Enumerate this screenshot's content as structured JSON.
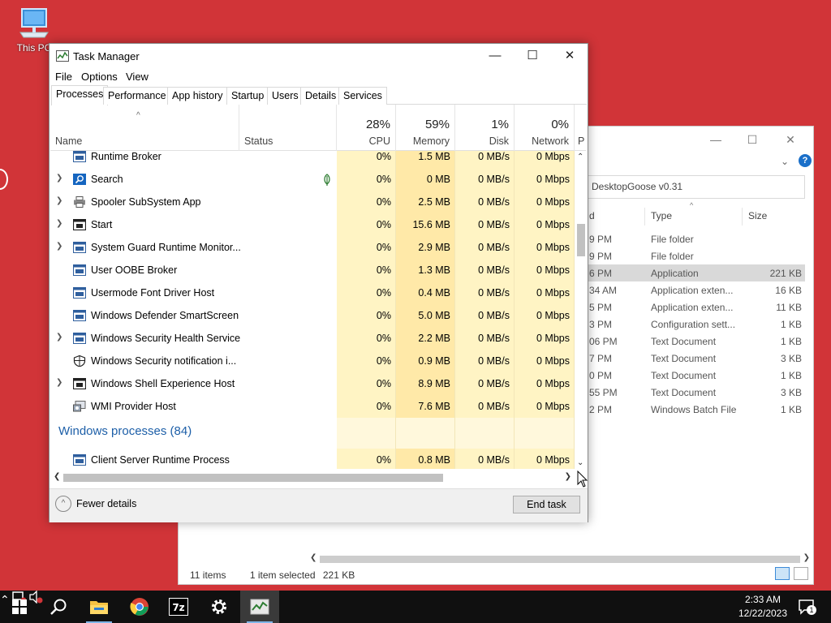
{
  "desktop": {
    "icon_label": "This PC"
  },
  "explorer": {
    "address": "DesktopGoose v0.31",
    "columns": {
      "date_fragment": "d",
      "type": "Type",
      "size": "Size"
    },
    "rows": [
      {
        "date": "9 PM",
        "type": "File folder",
        "size": ""
      },
      {
        "date": "9 PM",
        "type": "File folder",
        "size": ""
      },
      {
        "date": "6 PM",
        "type": "Application",
        "size": "221 KB",
        "selected": true
      },
      {
        "date": "34 AM",
        "type": "Application exten...",
        "size": "16 KB"
      },
      {
        "date": "5 PM",
        "type": "Application exten...",
        "size": "11 KB"
      },
      {
        "date": "3 PM",
        "type": "Configuration sett...",
        "size": "1 KB"
      },
      {
        "date": "06 PM",
        "type": "Text Document",
        "size": "1 KB"
      },
      {
        "date": "7 PM",
        "type": "Text Document",
        "size": "3 KB"
      },
      {
        "date": "0 PM",
        "type": "Text Document",
        "size": "1 KB"
      },
      {
        "date": "55 PM",
        "type": "Text Document",
        "size": "3 KB"
      },
      {
        "date": "2 PM",
        "type": "Windows Batch File",
        "size": "1 KB"
      }
    ],
    "status": {
      "items": "11 items",
      "selected": "1 item selected",
      "size": "221 KB"
    }
  },
  "taskmanager": {
    "title": "Task Manager",
    "menu": [
      "File",
      "Options",
      "View"
    ],
    "tabs": [
      "Processes",
      "Performance",
      "App history",
      "Startup",
      "Users",
      "Details",
      "Services"
    ],
    "active_tab": "Processes",
    "headers": {
      "name": "Name",
      "status": "Status",
      "cpu_pct": "28%",
      "cpu": "CPU",
      "mem_pct": "59%",
      "mem": "Memory",
      "disk_pct": "1%",
      "disk": "Disk",
      "net_pct": "0%",
      "net": "Network",
      "power_fragment": "P"
    },
    "processes": [
      {
        "name": "Runtime Broker",
        "expand": false,
        "icon": "app-window-icon",
        "cpu": "0%",
        "mem": "1.5 MB",
        "disk": "0 MB/s",
        "net": "0 Mbps"
      },
      {
        "name": "Search",
        "expand": true,
        "icon": "search-icon",
        "leaf": true,
        "cpu": "0%",
        "mem": "0 MB",
        "disk": "0 MB/s",
        "net": "0 Mbps"
      },
      {
        "name": "Spooler SubSystem App",
        "expand": true,
        "icon": "printer-icon",
        "cpu": "0%",
        "mem": "2.5 MB",
        "disk": "0 MB/s",
        "net": "0 Mbps"
      },
      {
        "name": "Start",
        "expand": true,
        "icon": "start-window-icon",
        "cpu": "0%",
        "mem": "15.6 MB",
        "disk": "0 MB/s",
        "net": "0 Mbps"
      },
      {
        "name": "System Guard Runtime Monitor...",
        "expand": true,
        "icon": "app-window-icon",
        "cpu": "0%",
        "mem": "2.9 MB",
        "disk": "0 MB/s",
        "net": "0 Mbps"
      },
      {
        "name": "User OOBE Broker",
        "expand": false,
        "icon": "app-window-icon",
        "cpu": "0%",
        "mem": "1.3 MB",
        "disk": "0 MB/s",
        "net": "0 Mbps"
      },
      {
        "name": "Usermode Font Driver Host",
        "expand": false,
        "icon": "app-window-icon",
        "cpu": "0%",
        "mem": "0.4 MB",
        "disk": "0 MB/s",
        "net": "0 Mbps"
      },
      {
        "name": "Windows Defender SmartScreen",
        "expand": false,
        "icon": "app-window-icon",
        "cpu": "0%",
        "mem": "5.0 MB",
        "disk": "0 MB/s",
        "net": "0 Mbps"
      },
      {
        "name": "Windows Security Health Service",
        "expand": true,
        "icon": "app-window-icon",
        "cpu": "0%",
        "mem": "2.2 MB",
        "disk": "0 MB/s",
        "net": "0 Mbps"
      },
      {
        "name": "Windows Security notification i...",
        "expand": false,
        "icon": "shield-icon",
        "cpu": "0%",
        "mem": "0.9 MB",
        "disk": "0 MB/s",
        "net": "0 Mbps"
      },
      {
        "name": "Windows Shell Experience Host",
        "expand": true,
        "icon": "start-window-icon",
        "cpu": "0%",
        "mem": "8.9 MB",
        "disk": "0 MB/s",
        "net": "0 Mbps"
      },
      {
        "name": "WMI Provider Host",
        "expand": false,
        "icon": "wmi-icon",
        "cpu": "0%",
        "mem": "7.6 MB",
        "disk": "0 MB/s",
        "net": "0 Mbps"
      }
    ],
    "section": "Windows processes (84)",
    "section_rows": [
      {
        "name": "Client Server Runtime Process",
        "expand": false,
        "icon": "app-window-icon",
        "cpu": "0%",
        "mem": "0.8 MB",
        "disk": "0 MB/s",
        "net": "0 Mbps"
      }
    ],
    "footer": {
      "fewer": "Fewer details",
      "end_task": "End task"
    }
  },
  "taskbar": {
    "time": "2:33 AM",
    "date": "12/22/2023",
    "notification_count": "1",
    "apps": [
      "start",
      "search",
      "file-explorer",
      "chrome",
      "7zip",
      "settings",
      "task-manager"
    ]
  },
  "colors": {
    "desktop": "#d13438",
    "heat_light": "#fff4c4",
    "heat_mid": "#ffe9a8",
    "section": "#1d5fa8"
  }
}
